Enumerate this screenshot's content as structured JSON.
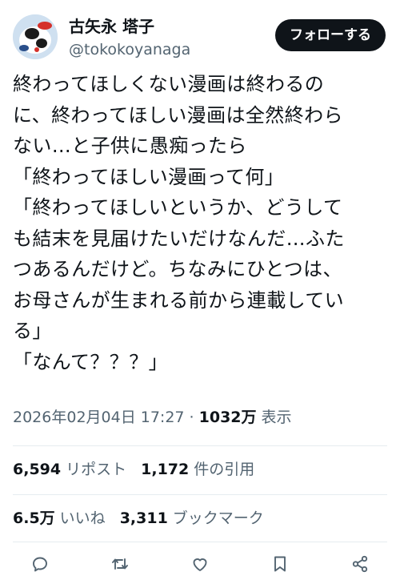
{
  "user": {
    "display_name": "古矢永 塔子",
    "handle": "@tokokoyanaga",
    "follow_label": "フォローする"
  },
  "tweet": {
    "lines": [
      "終わってほしくない漫画は終わるの",
      "に、終わってほしい漫画は全然終わら",
      "ない…と子供に愚痴ったら",
      "「終わってほしい漫画って何」",
      "「終わってほしいというか、どうして",
      "も結末を見届けたいだけなんだ…ふた",
      "つあるんだけど。ちなみにひとつは、",
      "お母さんが生まれる前から連載してい",
      "る」",
      "「なんて？？？」"
    ]
  },
  "meta": {
    "timestamp": "2026年02月04日 17:27 · ",
    "views": "1032万",
    "views_label": " 表示"
  },
  "stats": {
    "reposts": "6,594",
    "reposts_label": "リポスト",
    "quotes": "1,172",
    "quotes_label": "件の引用",
    "likes": "6.5万",
    "likes_label": "いいね",
    "bookmarks": "3,311",
    "bookmarks_label": "ブックマーク"
  },
  "actions": [
    "reply-icon",
    "repost-icon",
    "like-icon",
    "bookmark-icon",
    "share-icon"
  ],
  "colors": {
    "text": "#0f1419",
    "secondary": "#536471",
    "divider": "#e6ecf0",
    "follow_button_bg": "#0f1419"
  }
}
